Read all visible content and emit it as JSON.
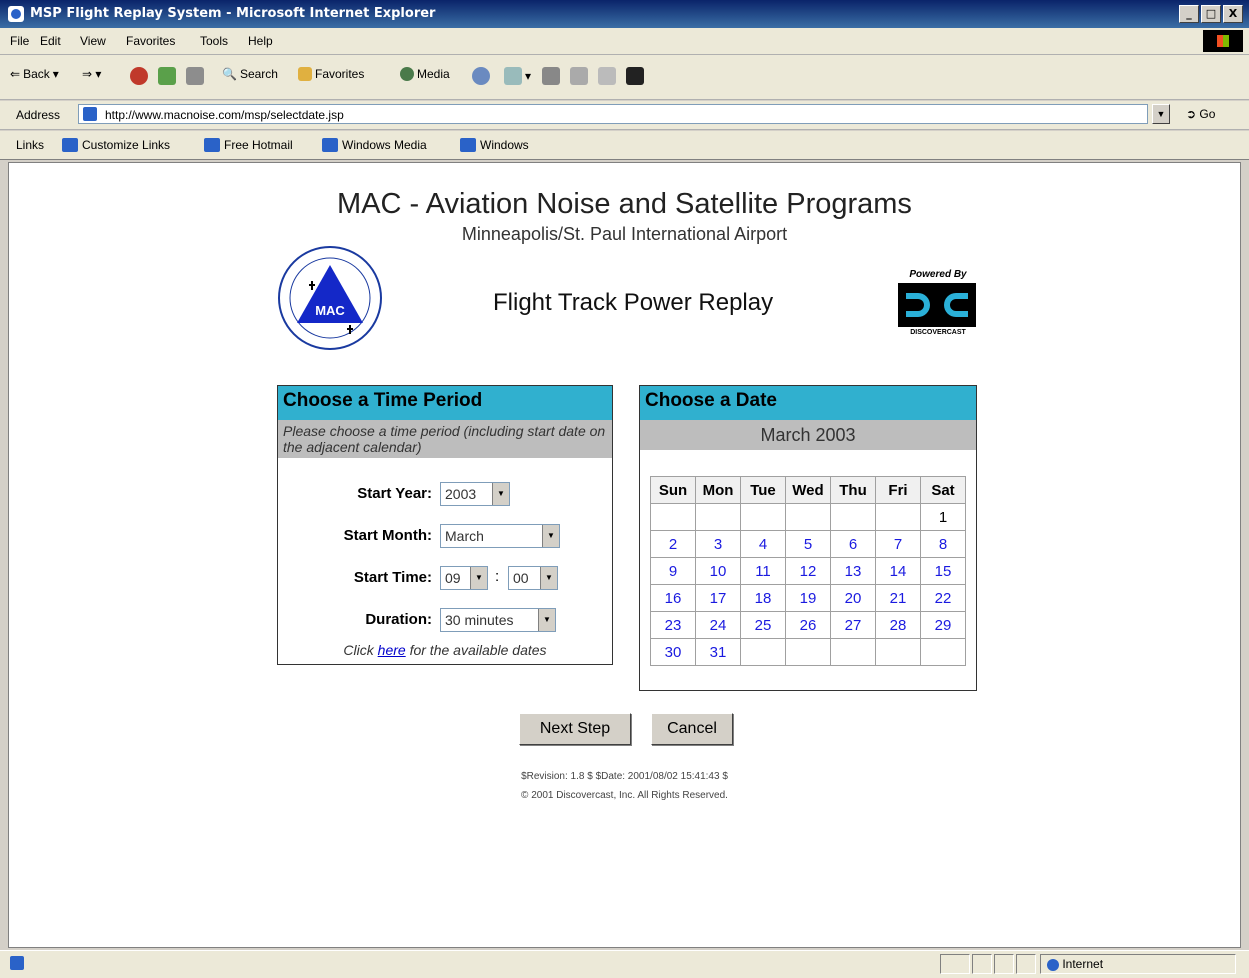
{
  "window": {
    "title": "MSP Flight Replay System - Microsoft Internet Explorer",
    "buttons": [
      "_",
      "□",
      "X"
    ]
  },
  "menu": [
    "File",
    "Edit",
    "View",
    "Favorites",
    "Tools",
    "Help"
  ],
  "toolbar": {
    "back": "Back",
    "search": "Search",
    "favorites": "Favorites",
    "media": "Media"
  },
  "address": {
    "label": "Address",
    "url": "http://www.macnoise.com/msp/selectdate.jsp",
    "go": "Go"
  },
  "links": {
    "label": "Links",
    "items": [
      "Customize Links",
      "Free Hotmail",
      "Windows Media",
      "Windows"
    ]
  },
  "page": {
    "title": "MAC - Aviation Noise and Satellite Programs",
    "subtitle": "Minneapolis/St. Paul International Airport",
    "heading": "Flight Track Power Replay",
    "mac_logo_text": "MAC",
    "powered_by": "Powered By",
    "dc_brand": "DISCOVERCAST"
  },
  "time_panel": {
    "title": "Choose a Time Period",
    "instruction": "Please choose a time period (including start date on the adjacent calendar)",
    "start_year_label": "Start Year:",
    "start_year": "2003",
    "start_month_label": "Start Month:",
    "start_month": "March",
    "start_time_label": "Start Time:",
    "start_hour": "09",
    "start_minute": "00",
    "time_sep": ":",
    "duration_label": "Duration:",
    "duration": "30 minutes",
    "note_prefix": "Click",
    "note_link": "here",
    "note_suffix": "for the available dates"
  },
  "date_panel": {
    "title": "Choose a Date",
    "month": "March 2003",
    "days": [
      "Sun",
      "Mon",
      "Tue",
      "Wed",
      "Thu",
      "Fri",
      "Sat"
    ],
    "weeks": [
      [
        "",
        "",
        "",
        "",
        "",
        "",
        "1"
      ],
      [
        "2",
        "3",
        "4",
        "5",
        "6",
        "7",
        "8"
      ],
      [
        "9",
        "10",
        "11",
        "12",
        "13",
        "14",
        "15"
      ],
      [
        "16",
        "17",
        "18",
        "19",
        "20",
        "21",
        "22"
      ],
      [
        "23",
        "24",
        "25",
        "26",
        "27",
        "28",
        "29"
      ],
      [
        "30",
        "31",
        "",
        "",
        "",
        "",
        ""
      ]
    ]
  },
  "buttons": {
    "next": "Next Step",
    "cancel": "Cancel"
  },
  "footer": {
    "revision": "$Revision: 1.8 $ $Date: 2001/08/02 15:41:43 $",
    "copyright": "© 2001 Discovercast, Inc. All Rights Reserved."
  },
  "status": {
    "zone": "Internet"
  }
}
